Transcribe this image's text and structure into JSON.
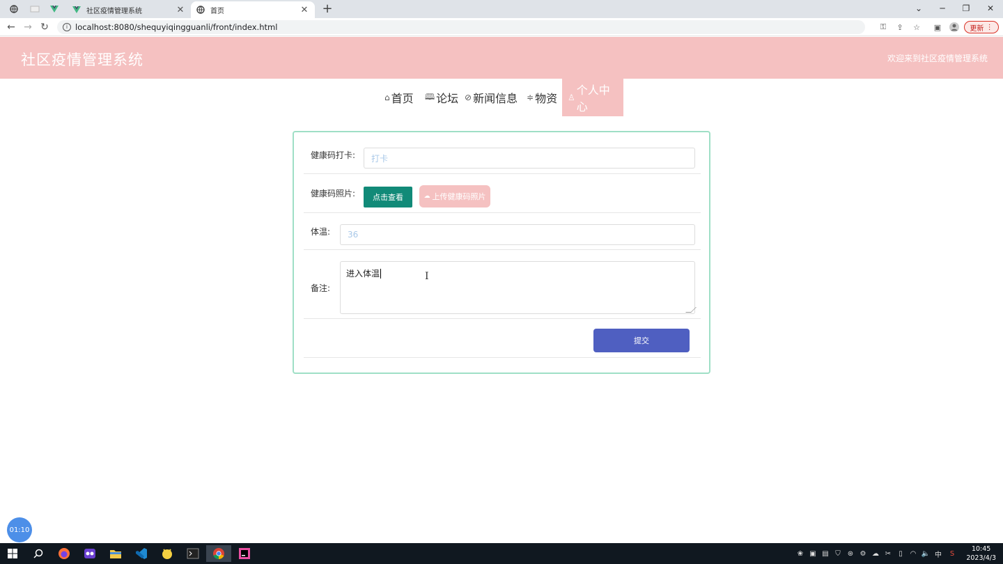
{
  "browser": {
    "tabs": [
      {
        "title": "社区疫情管理系统",
        "active": false
      },
      {
        "title": "首页",
        "active": true
      }
    ],
    "new_tab": "+",
    "url": "localhost:8080/shequyiqingguanli/front/index.html",
    "update_label": "更新"
  },
  "header": {
    "site_title": "社区疫情管理系统",
    "welcome": "欢迎来到社区疫情管理系统"
  },
  "menu": {
    "items": [
      {
        "icon": "home-icon",
        "label": "首页"
      },
      {
        "icon": "forum-icon",
        "label": "论坛"
      },
      {
        "icon": "tag-icon",
        "label": "新闻信息"
      },
      {
        "icon": "sliders-icon",
        "label": "物资"
      },
      {
        "icon": "user-icon",
        "label": "个人中心",
        "active": true
      }
    ]
  },
  "form": {
    "checkin_label": "健康码打卡:",
    "checkin_placeholder": "打卡",
    "photo_label": "健康码照片:",
    "view_button": "点击查看",
    "upload_button": "上传健康码照片",
    "temperature_label": "体温:",
    "temperature_placeholder": "36",
    "note_label": "备注:",
    "note_value": "进入体温",
    "submit_button": "提交"
  },
  "timer": "01:10",
  "taskbar": {
    "time": "10:45",
    "date": "2023/4/3",
    "ime": "中"
  },
  "colors": {
    "header_bg": "#f5c1c1",
    "card_border": "#9fdfc6",
    "view_button": "#118a78",
    "submit_button": "#4f5fc1"
  }
}
